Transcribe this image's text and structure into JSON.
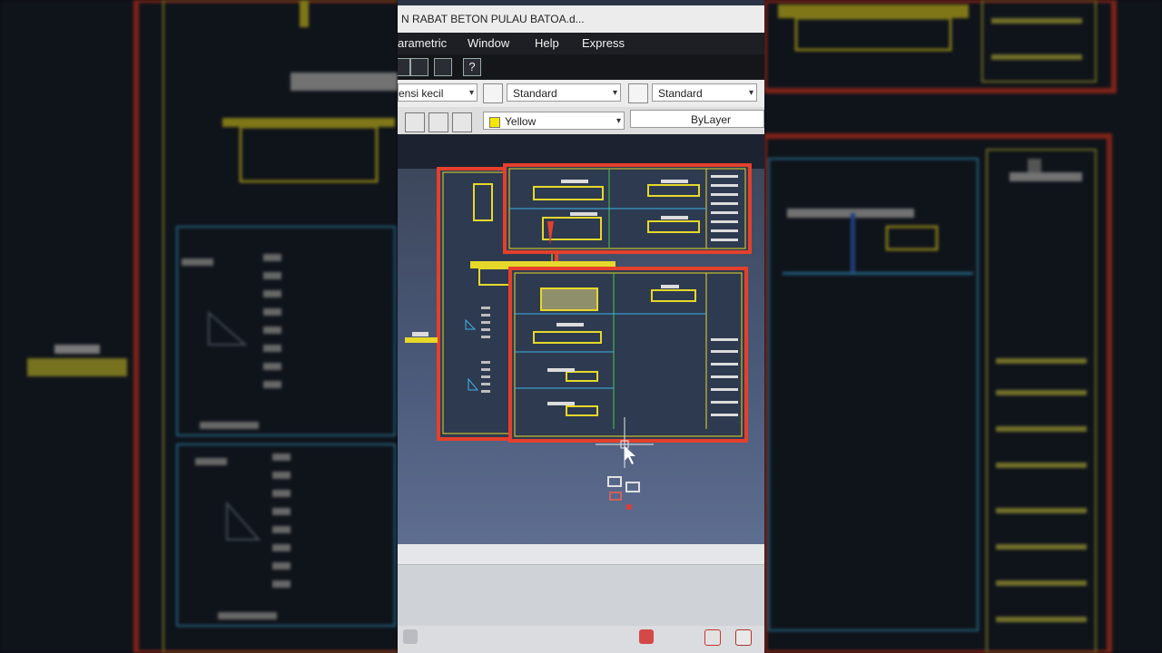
{
  "window": {
    "title": "N RABAT BETON PULAU BATOA.d..."
  },
  "menu": {
    "items": [
      "arametric",
      "Window",
      "Help",
      "Express"
    ]
  },
  "toolbar": {
    "dim_style": "ensi kecil",
    "text_style": "Standard",
    "table_style": "Standard",
    "color": "Yellow",
    "linetype": "ByLayer"
  },
  "icons": [
    "layer-icon",
    "text-style-icon",
    "table-style-icon",
    "help-icon",
    "crosshair-cursor-icon"
  ],
  "colors": {
    "frame_red": "#e4402c",
    "line_yellow": "#e6d82a",
    "line_green": "#46c84a",
    "line_cyan": "#3fb2e8",
    "background": "#4a5878"
  }
}
